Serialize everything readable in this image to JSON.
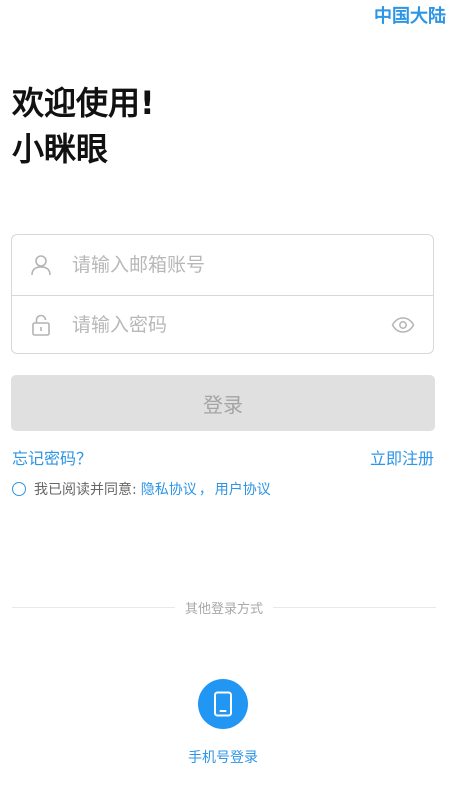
{
  "header": {
    "region_label": "中国大陆"
  },
  "welcome": {
    "line1": "欢迎使用!",
    "line2": "小眯眼"
  },
  "form": {
    "email_placeholder": "请输入邮箱账号",
    "password_placeholder": "请输入密码",
    "email_icon": "user-icon",
    "password_icon": "lock-icon",
    "visibility_icon": "eye-icon"
  },
  "actions": {
    "login_label": "登录",
    "forgot_password": "忘记密码？",
    "register": "立即注册"
  },
  "agreement": {
    "text": "我已阅读并同意:",
    "privacy": "隐私协议",
    "separator": "，",
    "user": "用户协议"
  },
  "alt_login": {
    "divider_label": "其他登录方式",
    "phone_label": "手机号登录",
    "phone_icon": "mobile-phone-icon"
  },
  "colors": {
    "accent": "#2d95e6",
    "button_disabled_bg": "#e0e0e0",
    "button_disabled_text": "#a4a4a4",
    "phone_button": "#2196f3"
  }
}
